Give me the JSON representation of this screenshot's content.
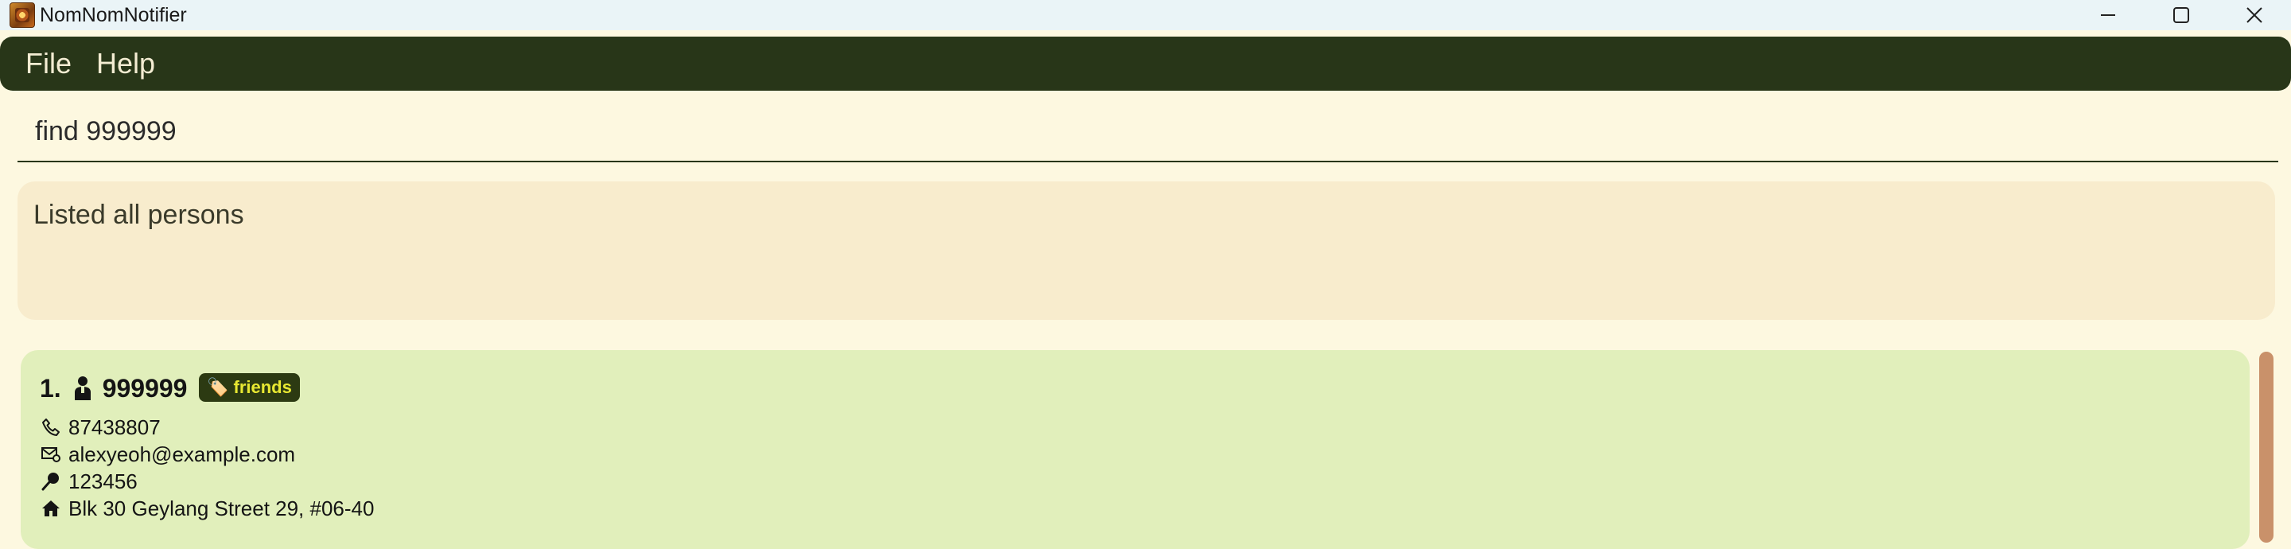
{
  "window": {
    "title": "NomNomNotifier",
    "icon": "app-logo-icon",
    "controls": [
      "minimize-icon",
      "maximize-icon",
      "close-icon"
    ]
  },
  "menu": {
    "file": "File",
    "help": "Help"
  },
  "command": {
    "value": "find 999999"
  },
  "result": {
    "message": "Listed all persons"
  },
  "persons": [
    {
      "index": "1.",
      "name": "999999",
      "tag": "🏷️ friends",
      "phone": "87438807",
      "email": "alexyeoh@example.com",
      "postal": "123456",
      "address": "Blk 30 Geylang Street 29, #06-40"
    }
  ],
  "colors": {
    "background": "#fdf8e0",
    "menubar": "#283618",
    "result_bg": "#f8eccd",
    "card_bg": "#e1efbb",
    "tag_bg": "#2c3a12",
    "tag_text": "#e8e832",
    "scrollbar": "#c9916a"
  }
}
